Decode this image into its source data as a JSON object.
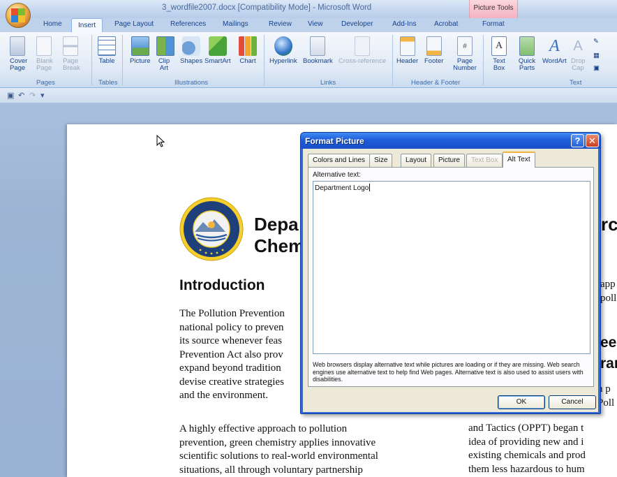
{
  "window": {
    "title": "3_wordfile2007.docx [Compatibility Mode] - Microsoft Word",
    "contextual_tab_group": "Picture Tools"
  },
  "tabs": [
    "Home",
    "Insert",
    "Page Layout",
    "References",
    "Mailings",
    "Review",
    "View",
    "Developer",
    "Add-Ins",
    "Acrobat",
    "Format"
  ],
  "active_tab": "Insert",
  "ribbon": {
    "pages_group": {
      "label": "Pages",
      "cover_page": "Cover Page",
      "blank_page": "Blank Page",
      "page_break": "Page Break"
    },
    "tables_group": {
      "label": "Tables",
      "table": "Table"
    },
    "illustrations_group": {
      "label": "Illustrations",
      "picture": "Picture",
      "clip_art": "Clip Art",
      "shapes": "Shapes",
      "smartart": "SmartArt",
      "chart": "Chart"
    },
    "links_group": {
      "label": "Links",
      "hyperlink": "Hyperlink",
      "bookmark": "Bookmark",
      "cross_reference": "Cross-reference"
    },
    "header_footer_group": {
      "label": "Header & Footer",
      "header": "Header",
      "footer": "Footer",
      "page_number": "Page Number"
    },
    "text_group": {
      "label": "Text",
      "text_box": "Text Box",
      "quick_parts": "Quick Parts",
      "wordart": "WordArt",
      "drop_cap": "Drop Cap"
    }
  },
  "document": {
    "heading_line1": "Depa",
    "heading_line2": "Chem",
    "heading_right": "rce",
    "introduction": "Introduction",
    "col1_para1": [
      "The Pollution Prevention",
      "national policy to preven",
      "its source whenever feas",
      "Prevention Act also prov",
      "expand beyond tradition",
      "devise creative strategies",
      "and the environment."
    ],
    "col1_para2": [
      "A highly effective approach to pollution",
      "prevention, green chemistry applies innovative",
      "scientific solutions to real-world environmental",
      "situations, all through voluntary partnership"
    ],
    "col2_frag1": [
      "app",
      "poll"
    ],
    "col2_heading": [
      "ee",
      "ran"
    ],
    "col2_frag2": [
      "n p",
      "Poll"
    ],
    "col2_para": [
      "and Tactics (OPPT) began t",
      "idea of providing new and i",
      "existing chemicals and prod",
      "them less hazardous to hum"
    ]
  },
  "dialog": {
    "title": "Format Picture",
    "help_symbol": "?",
    "close_symbol": "✕",
    "tabs": [
      "Colors and Lines",
      "Size",
      "Layout",
      "Picture",
      "Text Box",
      "Alt Text"
    ],
    "active_tab": "Alt Text",
    "alt_text_label": "Alternative text:",
    "alt_text_value": "Department Logo",
    "help_text": "Web browsers display alternative text while pictures are loading or if they are missing. Web search engines use alternative text to help find Web pages. Alternative text is also used to assist users with disabilities.",
    "ok_label": "OK",
    "cancel_label": "Cancel"
  },
  "colors": {
    "ribbon_text": "#15428b",
    "dialog_title_bar": "#1f5dd9",
    "active_tab_accent": "#f0b43a"
  }
}
